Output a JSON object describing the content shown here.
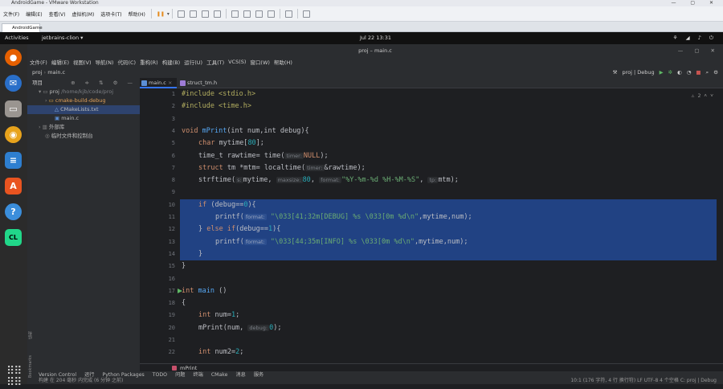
{
  "vmware": {
    "title": "AndroidGame - VMware Workstation",
    "menu": [
      "文件(F)",
      "编辑(E)",
      "查看(V)",
      "虚拟机(M)",
      "选项卡(T)",
      "帮助(H)"
    ],
    "tab": "AndroidGame"
  },
  "ubuntu": {
    "activities": "Activities",
    "app_menu": "jetbrains-clion ▾",
    "clock": "Jul 22  13:31"
  },
  "dock": {
    "items": [
      "firefox-icon",
      "thunderbird-icon",
      "files-icon",
      "rhythmbox-icon",
      "writer-icon",
      "software-icon",
      "help-icon",
      "clion-icon"
    ]
  },
  "ide": {
    "title": "proj – main.c",
    "menu": [
      "文件(F)",
      "编辑(E)",
      "视图(V)",
      "导航(N)",
      "代码(C)",
      "重构(R)",
      "构建(B)",
      "运行(U)",
      "工具(T)",
      "VCS(S)",
      "窗口(W)",
      "帮助(H)"
    ],
    "breadcrumb_project": "proj",
    "breadcrumb_file": "main.c",
    "run_config": "proj | Debug",
    "project_panel": {
      "title": "项目",
      "tree": [
        {
          "label": "proj",
          "path": "/home/kjb/code/proj",
          "indent": 0
        },
        {
          "label": "cmake-build-debug",
          "path": "",
          "indent": 1
        },
        {
          "label": "CMakeLists.txt",
          "path": "",
          "indent": 1
        },
        {
          "label": "main.c",
          "path": "",
          "indent": 1
        },
        {
          "label": "外部库",
          "path": "",
          "indent": 0
        },
        {
          "label": "临时文件和控制台",
          "path": "",
          "indent": 0
        }
      ]
    },
    "side_labels": [
      "Bookmarks",
      "结构"
    ],
    "tabs": [
      "main.c",
      "struct_tm.h"
    ],
    "inspection": "2",
    "code": {
      "line_numbers": [
        "1",
        "2",
        "3",
        "4",
        "5",
        "6",
        "7",
        "8",
        "9",
        "10",
        "11",
        "12",
        "13",
        "14",
        "15",
        "16",
        "17",
        "18",
        "19",
        "20",
        "21",
        "22"
      ],
      "l1": "#include <stdio.h>",
      "l2": "#include <time.h>",
      "l4a": "void",
      "l4b": " mPrint",
      "l4c": "(int num,int debug){",
      "l5a": "char",
      "l5b": " mytime[",
      "l5c": "80",
      "l5d": "];",
      "l6a": "time_t rawtime= time(",
      "l6h": "timer:",
      "l6b": "NULL",
      "l6c": ");",
      "l7a": "struct",
      "l7b": " tm *mtm= localtime(",
      "l7h": "timer:",
      "l7c": "&rawtime);",
      "l8a": "strftime(",
      "l8h1": "s:",
      "l8b": "mytime, ",
      "l8h2": "maxsize:",
      "l8c": "80",
      "l8d": ", ",
      "l8h3": "format:",
      "l8e": "\"%Y-%m-%d %H-%M-%S\"",
      "l8f": ", ",
      "l8h4": "tp:",
      "l8g": "mtm);",
      "l10a": "if",
      "l10b": " (debug==",
      "l10c": "0",
      "l10d": "){",
      "l11a": "printf(",
      "l11h": "format:",
      "l11b": "\"\\033[41;32m[DEBUG] %s \\033[0m %d\\n\"",
      "l11c": ",mytime,num);",
      "l12a": "} ",
      "l12b": "else if",
      "l12c": "(debug==",
      "l12d": "1",
      "l12e": "){",
      "l13a": "printf(",
      "l13h": "format:",
      "l13b": "\"\\033[44;35m[INFO] %s \\033[0m %d\\n\"",
      "l13c": ",mytime,num);",
      "l14": "}",
      "l15": "}",
      "l17a": "int",
      "l17b": " main",
      "l17c": " ()",
      "l18": "{",
      "l19a": "int",
      "l19b": " num=",
      "l19c": "1",
      "l19d": ";",
      "l20a": "mPrint(num, ",
      "l20h": "debug:",
      "l20b": "0",
      "l20c": ");",
      "l22a": "int",
      "l22b": " num2=",
      "l22c": "2",
      "l22d": ";"
    },
    "function_crumb": "mPrint",
    "tool_windows": [
      "Version Control",
      "运行",
      "Python Packages",
      "TODO",
      "问题",
      "终端",
      "CMake",
      "消息",
      "服务"
    ],
    "status_left": "构建 在 204 毫秒 内完成 (6 分钟 之前)",
    "status_right": "10:1 (176 字符, 4 行 换行符)   LF   UTF-8   4 个空格   C: proj | Debug"
  }
}
